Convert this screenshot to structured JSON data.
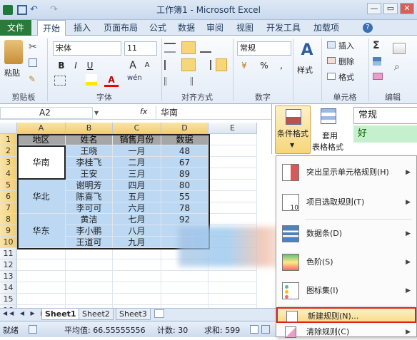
{
  "window": {
    "title": "工作簿1 - Microsoft Excel",
    "controls": [
      "—",
      "▭",
      "✕"
    ]
  },
  "tabs": {
    "file": "文件",
    "items": [
      "开始",
      "插入",
      "页面布局",
      "公式",
      "数据",
      "审阅",
      "视图",
      "开发工具",
      "加载项"
    ]
  },
  "ribbon": {
    "clipboard": {
      "paste": "粘贴",
      "label": "剪贴板"
    },
    "font": {
      "name": "宋体",
      "size": "11",
      "label": "字体",
      "bold": "B",
      "italic": "I",
      "underline": "U",
      "grow": "A",
      "shrink": "A",
      "color_a": "A",
      "wen": "wén"
    },
    "alignment": {
      "label": "对齐方式"
    },
    "number": {
      "format": "常规",
      "label": "数字",
      "percent": "%",
      "comma": ","
    },
    "styles": {
      "label": "样式"
    },
    "cells": {
      "insert": "插入",
      "delete": "删除",
      "format": "格式",
      "label": "单元格"
    },
    "editing": {
      "label": "编辑",
      "sum": "Σ"
    }
  },
  "formula_bar": {
    "name_box": "A2",
    "fx": "fx",
    "value": "华南"
  },
  "style_panel": {
    "conditional_format": "条件格式",
    "format_as_table_1": "套用",
    "format_as_table_2": "表格格式",
    "normal": "常规",
    "good": "好"
  },
  "grid": {
    "columns": [
      "A",
      "B",
      "C",
      "D",
      "E"
    ],
    "rows": [
      "1",
      "2",
      "3",
      "4",
      "5",
      "6",
      "7",
      "8",
      "9",
      "10",
      "11",
      "12",
      "13",
      "14",
      "15",
      "16"
    ],
    "headers": [
      "地区",
      "姓名",
      "销售月份",
      "数据"
    ],
    "regions": [
      "华南",
      "华北",
      "华东"
    ],
    "names": [
      "王晓",
      "李桂飞",
      "王安",
      "谢明芳",
      "陈喜飞",
      "李可可",
      "黄洁",
      "李小鹏",
      "王道可"
    ],
    "months": [
      "一月",
      "二月",
      "三月",
      "四月",
      "五月",
      "六月",
      "七月",
      "八月",
      "九月"
    ],
    "values": [
      "48",
      "67",
      "89",
      "80",
      "55",
      "78",
      "92",
      "",
      ""
    ]
  },
  "cf_menu": {
    "items": [
      {
        "label": "突出显示单元格规则(H)"
      },
      {
        "label": "项目选取规则(T)"
      },
      {
        "label": "数据条(D)"
      },
      {
        "label": "色阶(S)"
      },
      {
        "label": "图标集(I)"
      }
    ],
    "new_rule": "新建规则(N)...",
    "clear_rules": "清除规则(C)"
  },
  "sheets": {
    "tabs": [
      "Sheet1",
      "Sheet2",
      "Sheet3"
    ]
  },
  "status": {
    "ready": "就绪",
    "average": "平均值: 66.55555556",
    "count": "计数: 30",
    "sum": "求和: 599"
  }
}
